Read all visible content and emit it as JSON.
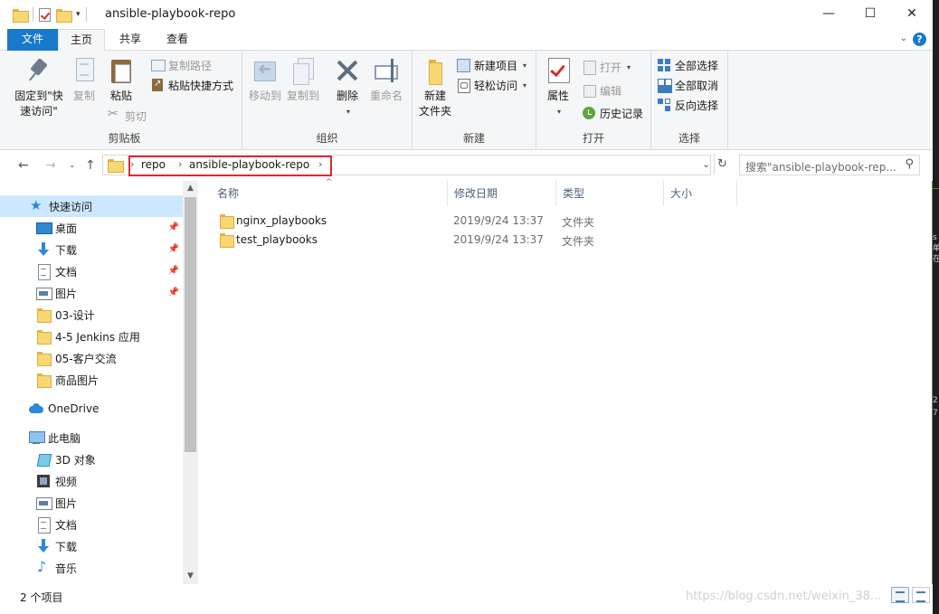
{
  "window": {
    "title": "ansible-playbook-repo",
    "controls": {
      "minimize": "—",
      "maximize": "☐",
      "close": "✕"
    }
  },
  "ribbon_tabs": [
    {
      "label": "文件"
    },
    {
      "label": "主页"
    },
    {
      "label": "共享"
    },
    {
      "label": "查看"
    }
  ],
  "ribbon": {
    "clipboard": {
      "group_label": "剪贴板",
      "pin_label_1": "固定到\"快",
      "pin_label_2": "速访问\"",
      "copy_label": "复制",
      "paste_label": "粘贴",
      "copy_path_label": "复制路径",
      "paste_shortcut_label": "粘贴快捷方式",
      "cut_label": "剪切"
    },
    "organize": {
      "group_label": "组织",
      "move_to_label": "移动到",
      "copy_to_label": "复制到",
      "delete_label": "删除",
      "rename_label": "重命名"
    },
    "new": {
      "group_label": "新建",
      "new_folder_label_1": "新建",
      "new_folder_label_2": "文件夹",
      "new_item_label": "新建项目",
      "easy_access_label": "轻松访问"
    },
    "open": {
      "group_label": "打开",
      "properties_label": "属性",
      "open_label": "打开",
      "edit_label": "编辑",
      "history_label": "历史记录"
    },
    "select": {
      "group_label": "选择",
      "select_all_label": "全部选择",
      "select_none_label": "全部取消",
      "invert_label": "反向选择"
    }
  },
  "address": {
    "crumbs": [
      "repo",
      "ansible-playbook-repo"
    ],
    "highlight_color": "#e0282e"
  },
  "search": {
    "placeholder": "搜索\"ansible-playbook-rep..."
  },
  "nav": {
    "items": [
      {
        "label": "快速访问",
        "icon": "star-icon"
      },
      {
        "label": "桌面",
        "icon": "desktop-icon",
        "pinned": true
      },
      {
        "label": "下载",
        "icon": "download-icon",
        "pinned": true
      },
      {
        "label": "文档",
        "icon": "document-icon",
        "pinned": true
      },
      {
        "label": "图片",
        "icon": "pictures-icon",
        "pinned": true
      },
      {
        "label": "03-设计",
        "icon": "folder-icon"
      },
      {
        "label": "4-5 Jenkins 应用",
        "icon": "folder-icon"
      },
      {
        "label": "05-客户交流",
        "icon": "folder-icon"
      },
      {
        "label": "商品图片",
        "icon": "folder-icon"
      },
      {
        "label": "OneDrive",
        "icon": "onedrive-icon"
      },
      {
        "label": "此电脑",
        "icon": "this-pc-icon"
      },
      {
        "label": "3D 对象",
        "icon": "3d-objects-icon"
      },
      {
        "label": "视频",
        "icon": "videos-icon"
      },
      {
        "label": "图片",
        "icon": "pictures-icon"
      },
      {
        "label": "文档",
        "icon": "document-icon"
      },
      {
        "label": "下载",
        "icon": "download-icon"
      },
      {
        "label": "音乐",
        "icon": "music-icon"
      }
    ]
  },
  "columns": [
    "名称",
    "修改日期",
    "类型",
    "大小"
  ],
  "files": [
    {
      "name": "nginx_playbooks",
      "date": "2019/9/24 13:37",
      "type": "文件夹"
    },
    {
      "name": "test_playbooks",
      "date": "2019/9/24 13:37",
      "type": "文件夹"
    }
  ],
  "status": {
    "count": "2 个项目"
  },
  "watermark": "https://blog.csdn.net/weixin_38..."
}
